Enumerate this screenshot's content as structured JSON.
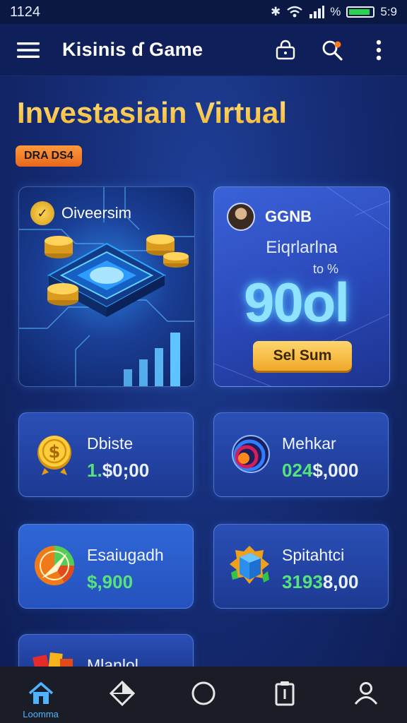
{
  "status_bar": {
    "time": "1124",
    "right_text": "% ",
    "clock_right": "5:9"
  },
  "app_bar": {
    "title": "Kisinis ɗ Game"
  },
  "headline": "Investasiain Virtual",
  "tag": "DRA DS4",
  "hero_card": {
    "label": "Oiveersim"
  },
  "offer_card": {
    "name": "GGNB",
    "subtitle": "Eiqrlarlna",
    "small": "to %",
    "big": "90ol",
    "button": "Sel Sum"
  },
  "stats": [
    {
      "title": "Dbiste",
      "value_prefix": "1.",
      "value_rest": "$0;00",
      "icon": "dollar-coin-icon"
    },
    {
      "title": "Mehkar",
      "value_prefix": "024",
      "value_rest": "$,000",
      "icon": "donut-chart-icon"
    },
    {
      "title": "Esaiugadh",
      "value_prefix": "$,900",
      "value_rest": "",
      "icon": "compass-pie-icon"
    },
    {
      "title": "Spitahtci",
      "value_prefix": "3193",
      "value_rest": "8,00",
      "icon": "cube-box-icon"
    },
    {
      "title": "Mlanlol",
      "icon": "bars-icon"
    }
  ],
  "bottom_nav": {
    "home_label": "Loomma"
  },
  "colors": {
    "accent": "#4fb4ff",
    "gold": "#f4b531",
    "green": "#56e37c"
  }
}
